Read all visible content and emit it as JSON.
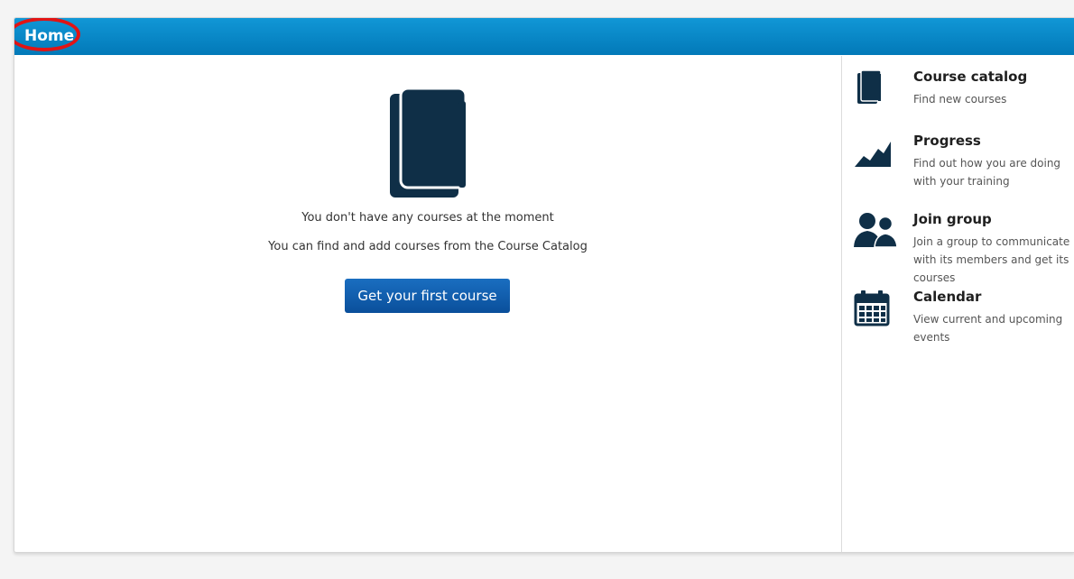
{
  "header": {
    "title": "Home"
  },
  "main": {
    "message_1": "You don't have any courses at the moment",
    "message_2": "You can find and add courses from the Course Catalog",
    "cta_label": "Get your first course"
  },
  "sidebar": {
    "items": [
      {
        "title": "Course catalog",
        "desc": "Find new courses",
        "icon": "book-icon"
      },
      {
        "title": "Progress",
        "desc": "Find out how you are doing with your training",
        "icon": "chart-icon"
      },
      {
        "title": "Join group",
        "desc": "Join a group to communicate with its members and get its courses",
        "icon": "group-icon"
      },
      {
        "title": "Calendar",
        "desc": "View current and upcoming events",
        "icon": "calendar-icon"
      }
    ]
  },
  "colors": {
    "header_blue": "#0a8cd0",
    "icon_dark": "#0f2f47",
    "cta_blue": "#0f5da9",
    "highlight_red": "#e11414"
  }
}
